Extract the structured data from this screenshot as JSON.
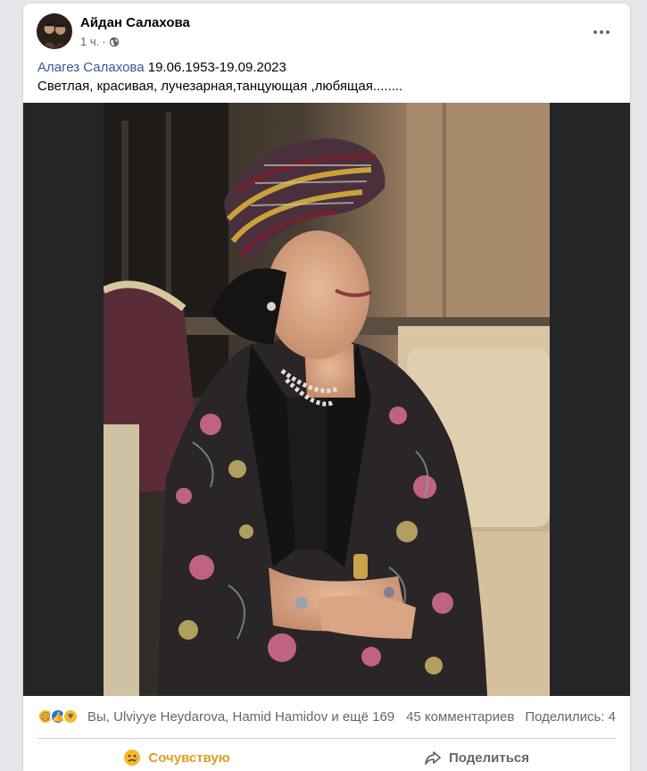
{
  "post": {
    "author": "Айдан Салахова",
    "time": "1 ч.",
    "separator": "·",
    "privacy_icon": "globe-icon",
    "text_link": "Алагез Салахова",
    "text_dates": " 19.06.1953-19.09.2023",
    "text_line2": "Светлая, красивая, лучезарная,танцующая ,любящая........"
  },
  "reactions": {
    "icons": [
      "sad-reaction-icon",
      "like-reaction-icon",
      "care-reaction-icon"
    ],
    "summary": "Вы, Ulviyye Heydarova, Hamid Hamidov и ещё 169",
    "comments": "45 комментариев",
    "shares": "Поделились: 4"
  },
  "actions": {
    "react_label": "Сочувствую",
    "share_label": "Поделиться"
  },
  "colors": {
    "link": "#385898",
    "active_reaction": "#e09d1e",
    "muted": "#65676b"
  }
}
